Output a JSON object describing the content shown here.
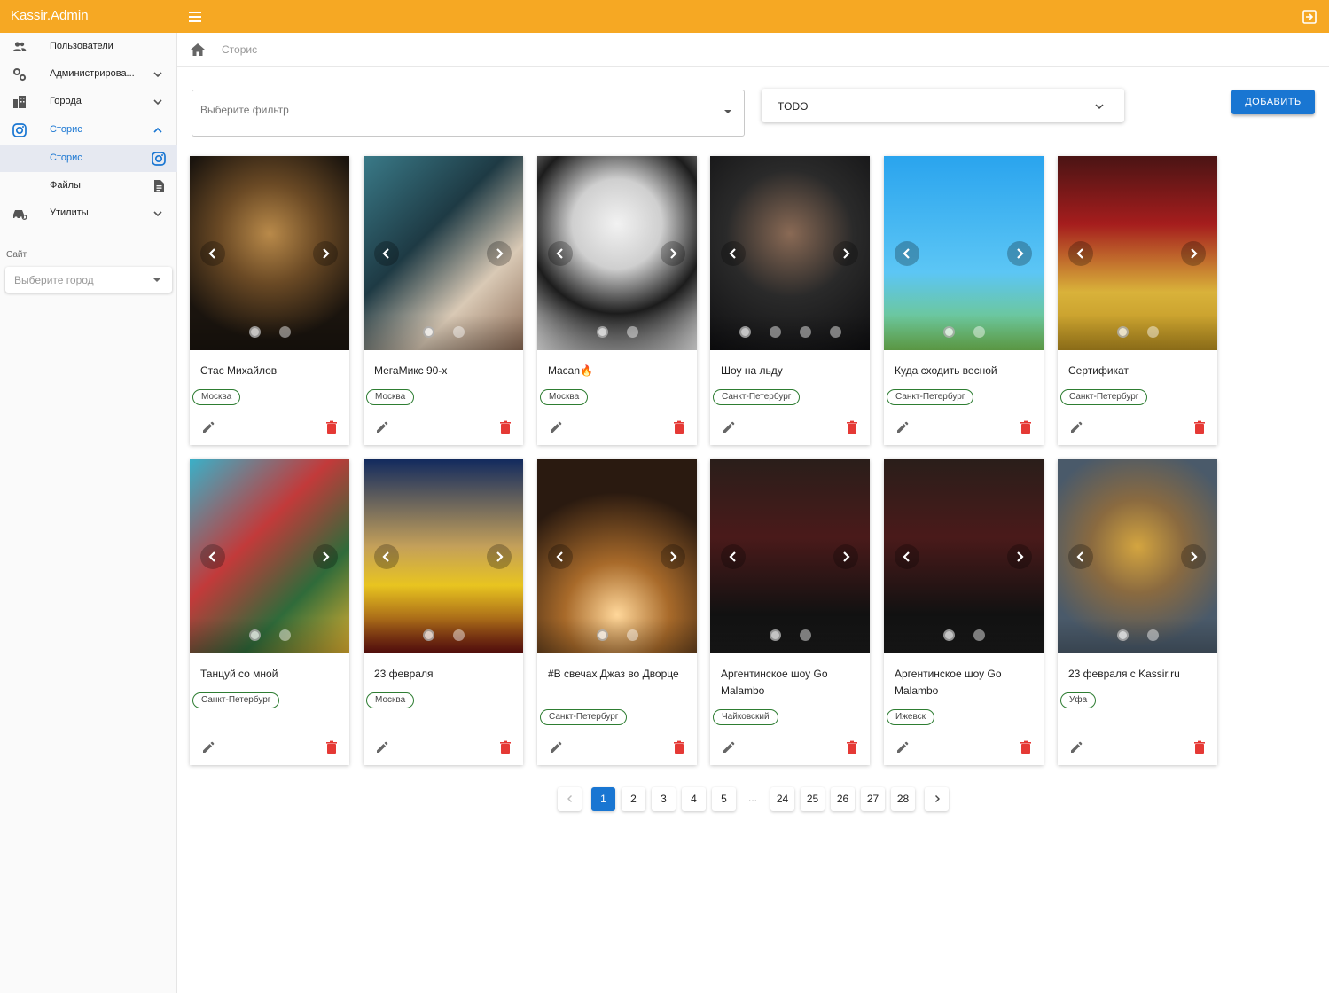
{
  "app": {
    "brand": "Kassir.Admin"
  },
  "sidebar": {
    "items": [
      {
        "label": "Пользователи",
        "icon": "users-icon"
      },
      {
        "label": "Администрирова...",
        "icon": "settings-gears-icon"
      },
      {
        "label": "Города",
        "icon": "city-icon"
      },
      {
        "label": "Сторис",
        "icon": "instagram-icon"
      },
      {
        "label": "Сторис",
        "icon": "instagram-icon"
      },
      {
        "label": "Файлы",
        "icon": "file-icon"
      },
      {
        "label": "Утилиты",
        "icon": "car-icon"
      }
    ],
    "site_label": "Сайт",
    "city_placeholder": "Выберите город"
  },
  "breadcrumb": {
    "current": "Сторис"
  },
  "toolbar": {
    "filter_placeholder": "Выберите фильтр",
    "todo_value": "TODO",
    "add_label": "ДОБАВИТЬ"
  },
  "cards": [
    {
      "title": "Стас Михайлов",
      "city": "Москва",
      "slides": 2,
      "active": 0
    },
    {
      "title": "МегаМикс 90-х",
      "city": "Москва",
      "slides": 2,
      "active": 0
    },
    {
      "title": "Macan🔥",
      "city": "Москва",
      "slides": 2,
      "active": 0
    },
    {
      "title": "Шоу на льду",
      "city": "Санкт-Петербург",
      "slides": 4,
      "active": 0
    },
    {
      "title": "Куда сходить весной",
      "city": "Санкт-Петербург",
      "slides": 2,
      "active": 0
    },
    {
      "title": "Сертификат",
      "city": "Санкт-Петербург",
      "slides": 2,
      "active": 0
    },
    {
      "title": "Танцуй со мной",
      "city": "Санкт-Петербург",
      "slides": 2,
      "active": 0
    },
    {
      "title": "23 февраля",
      "city": "Москва",
      "slides": 2,
      "active": 0
    },
    {
      "title": "#В свечах Джаз во Дворце",
      "city": "Санкт-Петербург",
      "slides": 2,
      "active": 0
    },
    {
      "title": "Аргентинское шоу Go Malambo",
      "city": "Чайковский",
      "slides": 2,
      "active": 0
    },
    {
      "title": "Аргентинское шоу Go Malambo",
      "city": "Ижевск",
      "slides": 2,
      "active": 0
    },
    {
      "title": "23 февраля с Kassir.ru",
      "city": "Уфа",
      "slides": 2,
      "active": 0
    }
  ],
  "pagination": {
    "pages_start": [
      "1",
      "2",
      "3",
      "4",
      "5"
    ],
    "ellipsis": "...",
    "pages_end": [
      "24",
      "25",
      "26",
      "27",
      "28"
    ],
    "current": "1"
  },
  "colors": {
    "topbar": "#f6a823",
    "accent": "#1976d2",
    "delete": "#e53935",
    "chip_border": "#2e7d32"
  }
}
